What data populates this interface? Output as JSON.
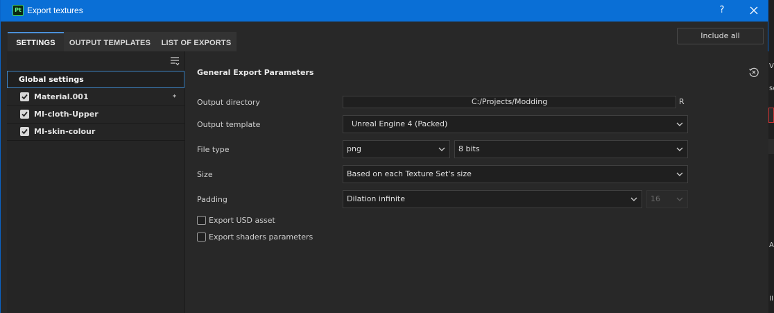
{
  "window": {
    "title": "Export textures",
    "app_badge": "Pt",
    "help_label": "?",
    "accent_color": "#0a6fd6"
  },
  "tabs": [
    {
      "label": "SETTINGS",
      "active": true
    },
    {
      "label": "OUTPUT TEMPLATES",
      "active": false
    },
    {
      "label": "LIST OF EXPORTS",
      "active": false
    }
  ],
  "include_all_label": "Include all",
  "sidebar": {
    "global_label": "Global settings",
    "materials": [
      {
        "label": "Material.001",
        "checked": true,
        "marker": "*"
      },
      {
        "label": "MI-cloth-Upper",
        "checked": true,
        "marker": ""
      },
      {
        "label": "MI-skin-colour",
        "checked": true,
        "marker": ""
      }
    ]
  },
  "params": {
    "section_title": "General Export Parameters",
    "output_directory": {
      "label": "Output directory",
      "value": "C:/Projects/Modding",
      "button": "R"
    },
    "output_template": {
      "label": "Output template",
      "value": "Unreal Engine 4 (Packed)"
    },
    "file_type": {
      "label": "File type",
      "format": "png",
      "bit_depth": "8 bits"
    },
    "size": {
      "label": "Size",
      "value": "Based on each Texture Set's size"
    },
    "padding": {
      "label": "Padding",
      "value": "Dilation infinite",
      "amount": "16"
    },
    "export_usd": {
      "label": "Export USD asset",
      "checked": false
    },
    "export_shaders": {
      "label": "Export shaders parameters",
      "checked": false
    }
  },
  "background_edge": {
    "chars": [
      "VE",
      "se",
      "Al",
      "II"
    ]
  }
}
